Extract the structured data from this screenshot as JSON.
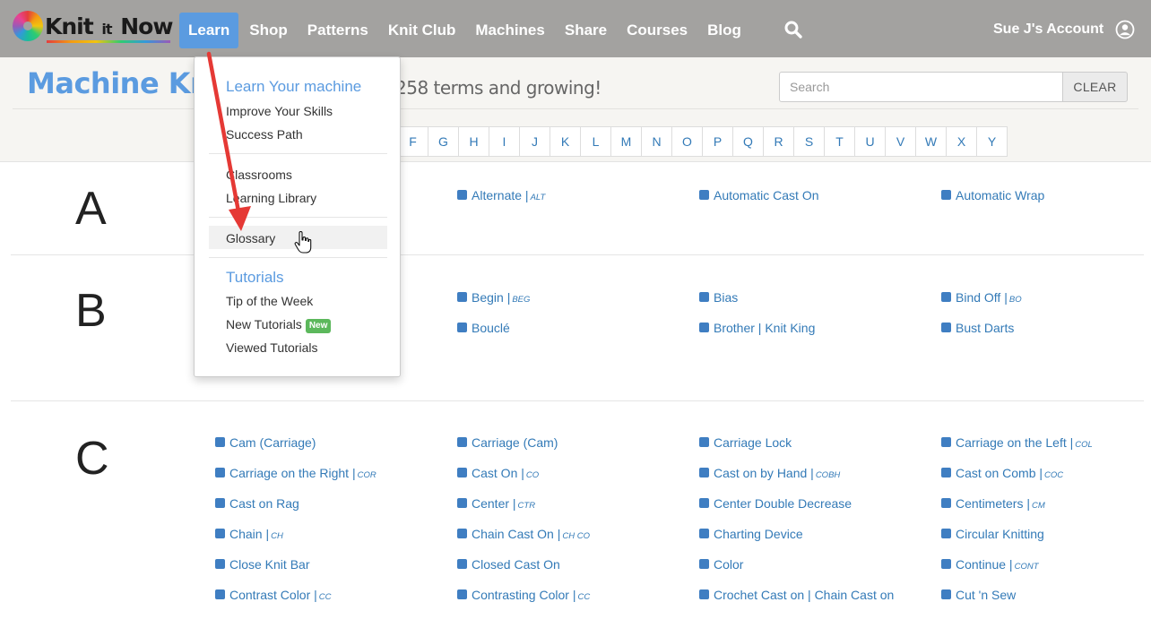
{
  "nav": {
    "logo": "Knit it Now",
    "items": [
      {
        "label": "Learn",
        "active": true
      },
      {
        "label": "Shop",
        "active": false
      },
      {
        "label": "Patterns",
        "active": false
      },
      {
        "label": "Knit Club",
        "active": false
      },
      {
        "label": "Machines",
        "active": false
      },
      {
        "label": "Share",
        "active": false
      },
      {
        "label": "Courses",
        "active": false
      },
      {
        "label": "Blog",
        "active": false
      }
    ],
    "search_icon": "search-icon",
    "account_label": "Sue J's Account",
    "account_icon": "user-circle-icon"
  },
  "header": {
    "title": "Machine Kn",
    "subtitle": "258 terms and growing!",
    "search_placeholder": "Search",
    "clear_label": "CLEAR"
  },
  "alphabet": [
    "F",
    "G",
    "H",
    "I",
    "J",
    "K",
    "L",
    "M",
    "N",
    "O",
    "P",
    "Q",
    "R",
    "S",
    "T",
    "U",
    "V",
    "W",
    "X",
    "Y"
  ],
  "dropdown": {
    "heading1": "Learn Your machine",
    "group1": [
      "Improve Your Skills",
      "Success Path"
    ],
    "group2": [
      "Classrooms",
      "Learning Library"
    ],
    "group3": [
      "Glossary"
    ],
    "heading2": "Tutorials",
    "group4": [
      "Tip of the Week",
      "New Tutorials",
      "Viewed Tutorials"
    ],
    "new_badge": "New"
  },
  "sections": [
    {
      "letter": "A",
      "terms": [
        {
          "label": "Alternate |",
          "abbr": "ALT"
        },
        {
          "label": "Automatic Cast On",
          "abbr": ""
        },
        {
          "label": "Automatic Wrap",
          "abbr": ""
        }
      ]
    },
    {
      "letter": "B",
      "terms": [
        {
          "label": "Begin |",
          "abbr": "BEG"
        },
        {
          "label": "Bias",
          "abbr": ""
        },
        {
          "label": "Bind Off |",
          "abbr": "BO"
        },
        {
          "label": "Bouclé",
          "abbr": ""
        },
        {
          "label": "Brother | Knit King",
          "abbr": ""
        },
        {
          "label": "Bust Darts",
          "abbr": ""
        }
      ]
    },
    {
      "letter": "C",
      "terms": [
        {
          "label": "Cam (Carriage)",
          "abbr": ""
        },
        {
          "label": "Carriage (Cam)",
          "abbr": ""
        },
        {
          "label": "Carriage Lock",
          "abbr": ""
        },
        {
          "label": "Carriage on the Left |",
          "abbr": "COL"
        },
        {
          "label": "Carriage on the Right |",
          "abbr": "COR"
        },
        {
          "label": "Cast On |",
          "abbr": "CO"
        },
        {
          "label": "Cast on by Hand |",
          "abbr": "COBH"
        },
        {
          "label": "Cast on Comb |",
          "abbr": "COC"
        },
        {
          "label": "Cast on Rag",
          "abbr": ""
        },
        {
          "label": "Center |",
          "abbr": "ctr"
        },
        {
          "label": "Center Double Decrease",
          "abbr": ""
        },
        {
          "label": "Centimeters |",
          "abbr": "Cm"
        },
        {
          "label": "Chain |",
          "abbr": "CH"
        },
        {
          "label": "Chain Cast On |",
          "abbr": "CH CO"
        },
        {
          "label": "Charting Device",
          "abbr": ""
        },
        {
          "label": "Circular Knitting",
          "abbr": ""
        },
        {
          "label": "Close Knit Bar",
          "abbr": ""
        },
        {
          "label": "Closed Cast On",
          "abbr": ""
        },
        {
          "label": "Color",
          "abbr": ""
        },
        {
          "label": "Continue |",
          "abbr": "CONT"
        },
        {
          "label": "Contrast Color |",
          "abbr": "CC"
        },
        {
          "label": "Contrasting Color |",
          "abbr": "CC"
        },
        {
          "label": "Crochet Cast on | Chain Cast on",
          "abbr": ""
        },
        {
          "label": "Cut 'n Sew",
          "abbr": ""
        }
      ]
    }
  ],
  "colors": {
    "nav_bg": "#a3a2a0",
    "accent": "#5b9be0",
    "link": "#337ab7",
    "badge_green": "#5cb85c",
    "annotation_red": "#e53935"
  }
}
